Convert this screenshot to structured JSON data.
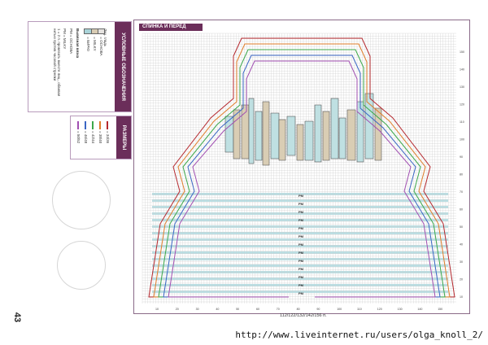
{
  "page": {
    "number": "43",
    "watermark": "http://www.liveinternet.ru/users/olga_knoll_2/"
  },
  "legend": {
    "title": "УСЛОВНЫЕ ОБОЗНАЧЕНИЯ",
    "subtitle": "Лиц. гладь",
    "items": [
      {
        "label": "= ОСНОВА",
        "color": "#e6e3e0"
      },
      {
        "label": "= MILKY",
        "color": "#d8cbb3"
      },
      {
        "label": "= БИРЮ",
        "color": "#a9d3d8"
      }
    ],
    "note_title": "Вывязная вязка",
    "notes": [
      "РМ = ОСНОВА",
      "РМ = MILKY"
    ],
    "footnote": "1 = 2 п. провязать вместе лиц., обвивая нитью против часовой стрелки"
  },
  "sizes": {
    "title": "РАЗМЕРЫ",
    "items": [
      {
        "label": "= 34/36",
        "color": "#b5282e"
      },
      {
        "label": "= 38/40",
        "color": "#e07d2a"
      },
      {
        "label": "= 42/44",
        "color": "#3ca84a"
      },
      {
        "label": "= 46/48",
        "color": "#3a66c4"
      },
      {
        "label": "= 50/52",
        "color": "#a14fb2"
      }
    ]
  },
  "chart": {
    "header": "СПИНКА И ПЕРЕД",
    "footer_label": "112/122/132/142/156 п.",
    "row_marker": "РМ",
    "right_axis_labels": [
      "150",
      "140",
      "130",
      "120",
      "110",
      "100",
      "90",
      "80",
      "70",
      "60",
      "50",
      "40",
      "30",
      "20",
      "10"
    ],
    "bottom_axis_labels": [
      "10",
      "20",
      "30",
      "40",
      "50",
      "60",
      "70",
      "80",
      "90",
      "100",
      "110",
      "120",
      "130",
      "140",
      "150"
    ],
    "grid_color": "#cfcfcf",
    "stripe_color": "#b9dfe4",
    "city_fill_light": "#bfe0e2",
    "city_fill_beige": "#d9cdb4",
    "outline_colors": [
      "#b5282e",
      "#e07d2a",
      "#3ca84a",
      "#3a66c4",
      "#a14fb2"
    ]
  }
}
